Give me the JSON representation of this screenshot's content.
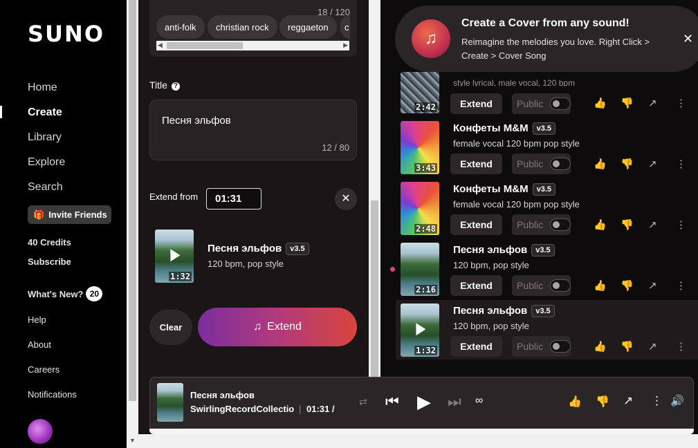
{
  "sidebar": {
    "logo": "SUNO",
    "nav": [
      "Home",
      "Create",
      "Library",
      "Explore",
      "Search"
    ],
    "invite": "Invite Friends",
    "credits": "40 Credits",
    "subscribe": "Subscribe",
    "whats_new": "What's New?",
    "whats_new_count": "20",
    "links": [
      "Help",
      "About",
      "Careers",
      "Notifications"
    ]
  },
  "create": {
    "tags_count": "18 / 120",
    "tags": [
      "anti-folk",
      "christian rock",
      "reggaeton",
      "c"
    ],
    "title_label": "Title",
    "title_value": "Песня эльфов",
    "title_count": "12 / 80",
    "extend_from_label": "Extend from",
    "extend_from_value": "01:31",
    "song": {
      "name": "Песня эльфов",
      "version": "v3.5",
      "style": "120 bpm, pop style",
      "duration": "1:32"
    },
    "clear_label": "Clear",
    "extend_label": "Extend"
  },
  "toast": {
    "title": "Create a Cover from any sound!",
    "text": "Reimagine the melodies you love. Right Click > Create > Cover Song"
  },
  "library": {
    "rows": [
      {
        "name": "",
        "version": "",
        "style": "style lyrical, male vocal, 120 bpm",
        "duration": "2:42",
        "thumb": "city"
      },
      {
        "name": "Конфеты M&M",
        "version": "v3.5",
        "style": "female vocal 120 bpm pop style",
        "duration": "3:43",
        "thumb": "swirl"
      },
      {
        "name": "Конфеты M&M",
        "version": "v3.5",
        "style": "female vocal 120 bpm pop style",
        "duration": "2:48",
        "thumb": "swirl"
      },
      {
        "name": "Песня эльфов",
        "version": "v3.5",
        "style": "120 bpm, pop style",
        "duration": "2:16",
        "thumb": "forest"
      },
      {
        "name": "Песня эльфов",
        "version": "v3.5",
        "style": "120 bpm, pop style",
        "duration": "1:32",
        "thumb": "forest"
      }
    ],
    "extend_label": "Extend",
    "public_label": "Public"
  },
  "player": {
    "title": "Песня эльфов",
    "artist": "SwirlingRecordCollection",
    "separator": "|",
    "time": "01:31 /"
  }
}
